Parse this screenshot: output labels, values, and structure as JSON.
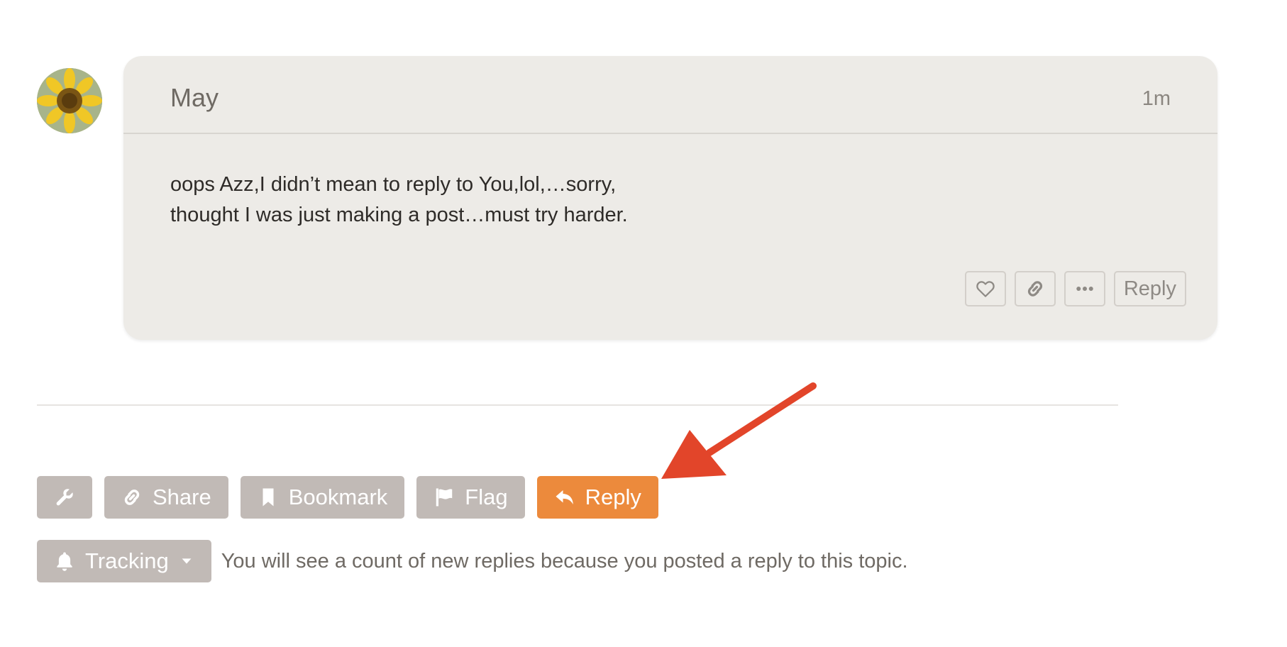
{
  "post": {
    "username": "May",
    "date": "1m",
    "body_lines": [
      "oops Azz,I didn’t mean to reply to You,lol,…sorry,",
      "thought I was just making a post…must try harder."
    ],
    "actions": {
      "like_icon": "heart-icon",
      "link_icon": "link-icon",
      "more_icon": "ellipsis-icon",
      "reply_label": "Reply"
    }
  },
  "topic_footer": {
    "admin_icon": "wrench-icon",
    "share_label": "Share",
    "bookmark_label": "Bookmark",
    "flag_label": "Flag",
    "reply_label": "Reply",
    "reply_color": "#ec8a3c",
    "button_color": "#c1bab6"
  },
  "notifications": {
    "level_label": "Tracking",
    "description": "You will see a count of new replies because you posted a reply to this topic."
  },
  "annotation": {
    "arrow_color": "#e2452a"
  }
}
